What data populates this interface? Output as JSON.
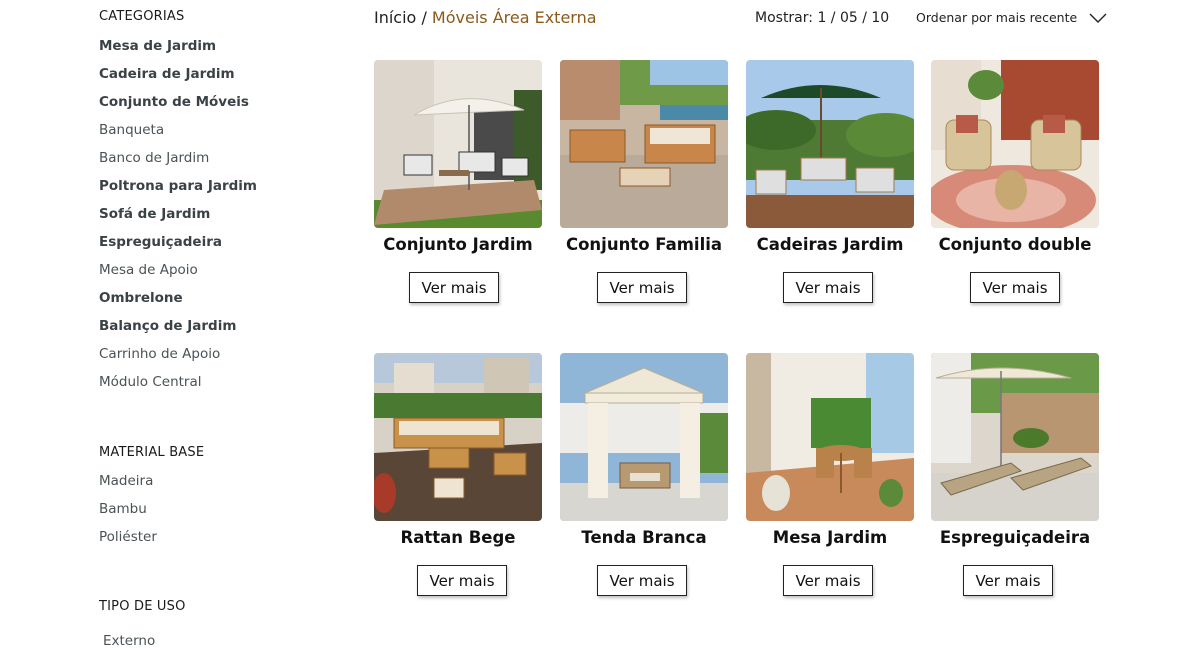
{
  "sidebar": {
    "categories_title": "CATEGORIAS",
    "categories": [
      {
        "label": "Mesa de Jardim",
        "bold": true
      },
      {
        "label": "Cadeira de Jardim",
        "bold": true
      },
      {
        "label": "Conjunto de Móveis",
        "bold": true
      },
      {
        "label": "Banqueta",
        "bold": false
      },
      {
        "label": "Banco de Jardim",
        "bold": false
      },
      {
        "label": "Poltrona para Jardim",
        "bold": true
      },
      {
        "label": "Sofá de Jardim",
        "bold": true
      },
      {
        "label": "Espreguiçadeira",
        "bold": true
      },
      {
        "label": "Mesa de Apoio",
        "bold": false
      },
      {
        "label": "Ombrelone",
        "bold": true
      },
      {
        "label": "Balanço de Jardim",
        "bold": true
      },
      {
        "label": "Carrinho de Apoio",
        "bold": false
      },
      {
        "label": "Módulo Central",
        "bold": false
      }
    ],
    "material_title": "MATERIAL BASE",
    "materials": [
      "Madeira",
      "Bambu",
      "Poliéster"
    ],
    "usage_title": "TIPO DE USO",
    "usages": [
      "Externo"
    ]
  },
  "breadcrumb": {
    "home": "Início",
    "separator": "/",
    "current": "Móveis Área Externa"
  },
  "toolbar": {
    "show_label": "Mostrar: 1 / 05 / 10",
    "sort_label": "Ordenar por mais recente",
    "sort_icon": "chevron-down-icon"
  },
  "products": [
    {
      "name": "Conjunto Jardim",
      "button": "Ver mais"
    },
    {
      "name": "Conjunto Familia",
      "button": "Ver mais"
    },
    {
      "name": "Cadeiras Jardim",
      "button": "Ver mais"
    },
    {
      "name": "Conjunto double",
      "button": "Ver mais"
    },
    {
      "name": "Rattan Bege",
      "button": "Ver mais"
    },
    {
      "name": "Tenda Branca",
      "button": "Ver mais"
    },
    {
      "name": "Mesa Jardim",
      "button": "Ver mais"
    },
    {
      "name": "Espreguiçadeira",
      "button": "Ver mais"
    }
  ],
  "colors": {
    "breadcrumb_current": "#8a5a1a",
    "sidebar_text": "#4a5256"
  }
}
